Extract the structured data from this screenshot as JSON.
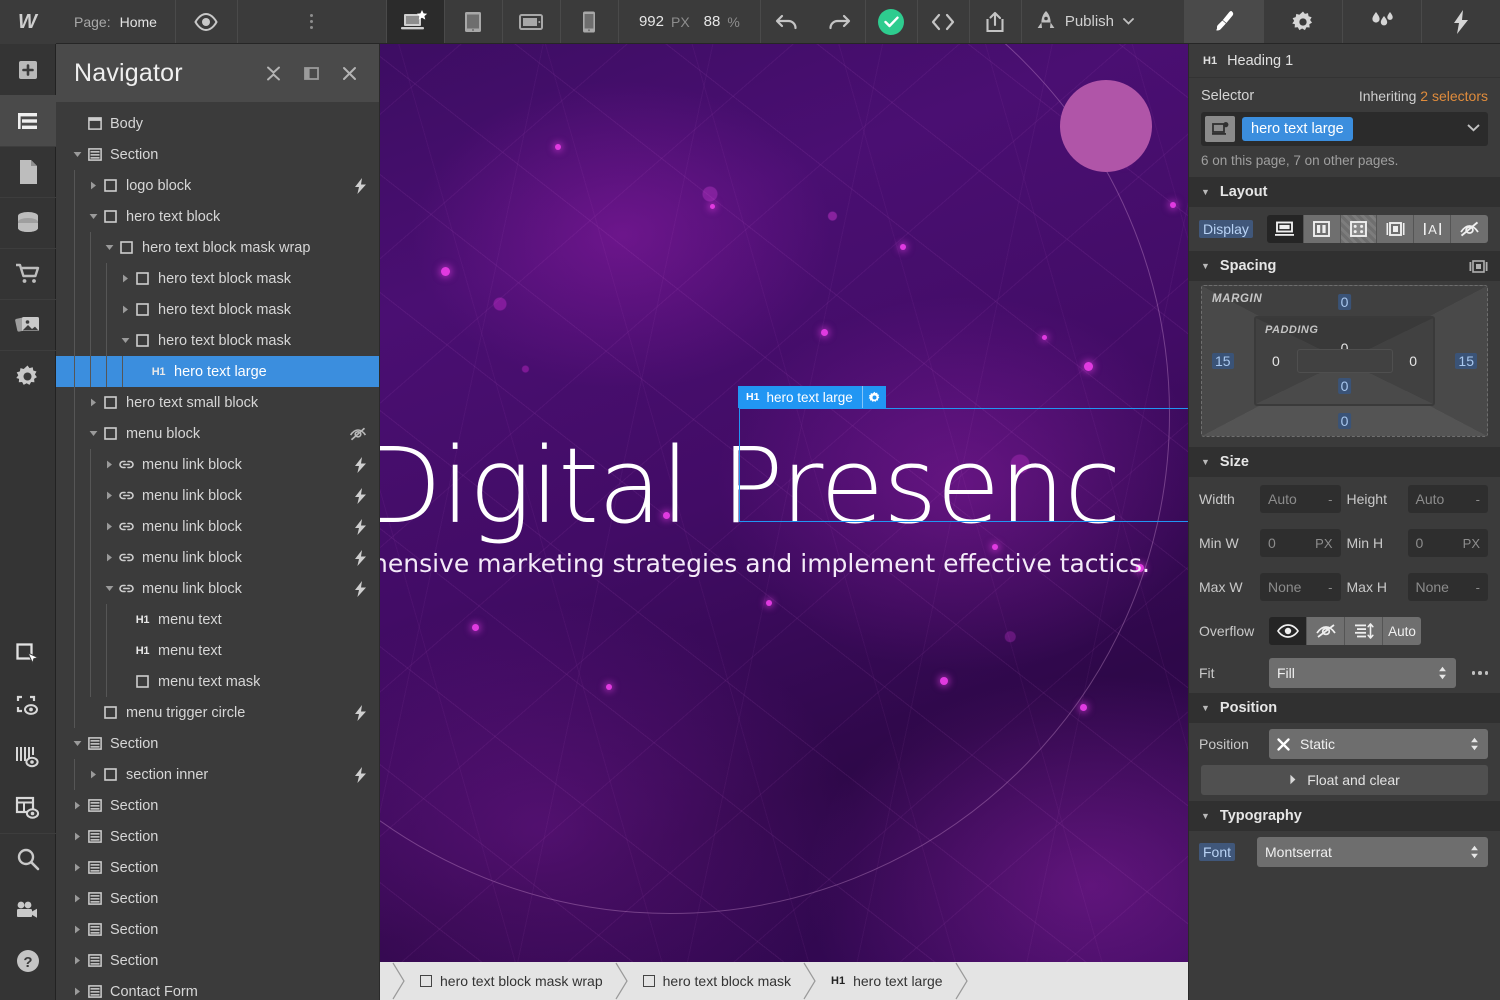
{
  "topbar": {
    "page_label": "Page:",
    "page_value": "Home",
    "preview_icon": "eye-icon",
    "more_icon": "more-options-icon",
    "devices": [
      {
        "name": "desktop",
        "icon": "desktop-icon",
        "active": true
      },
      {
        "name": "tablet",
        "icon": "tablet-icon",
        "active": false
      },
      {
        "name": "tablet-landscape",
        "icon": "tablet-landscape-icon",
        "active": false
      },
      {
        "name": "mobile",
        "icon": "mobile-icon",
        "active": false
      }
    ],
    "zoom_width": "992",
    "zoom_width_unit": "PX",
    "zoom_level": "88",
    "zoom_unit": "%",
    "undo_icon": "undo-icon",
    "redo_icon": "redo-icon",
    "status_icon": "check-circle-icon",
    "code_icon": "code-icon",
    "export_icon": "export-icon",
    "publish_label": "Publish",
    "publish_icon": "rocket-icon",
    "right_tabs": [
      {
        "name": "style",
        "icon": "paintbrush-icon",
        "active": true
      },
      {
        "name": "settings",
        "icon": "gear-icon",
        "active": false
      },
      {
        "name": "interactions",
        "icon": "droplets-icon",
        "active": false
      },
      {
        "name": "effects",
        "icon": "lightning-icon",
        "active": false
      }
    ]
  },
  "rail": {
    "logo": "W",
    "items": [
      {
        "name": "add-elements",
        "icon": "plus-icon"
      },
      {
        "name": "navigator",
        "icon": "navigator-icon",
        "active": true
      },
      {
        "name": "pages",
        "icon": "page-icon"
      },
      {
        "name": "cms",
        "icon": "database-icon"
      },
      {
        "name": "ecommerce",
        "icon": "cart-icon"
      },
      {
        "name": "assets",
        "icon": "images-icon"
      },
      {
        "name": "settings",
        "icon": "gear-icon"
      }
    ],
    "bottom_items": [
      {
        "name": "select-tool",
        "icon": "cursor-select-icon"
      },
      {
        "name": "show-element-outlines",
        "icon": "dashed-box-eye-icon"
      },
      {
        "name": "show-grid",
        "icon": "columns-eye-icon"
      },
      {
        "name": "show-layout",
        "icon": "layout-eye-icon"
      },
      {
        "name": "search",
        "icon": "search-icon"
      },
      {
        "name": "video-tutorials",
        "icon": "video-camera-icon"
      },
      {
        "name": "help",
        "icon": "question-circle-icon"
      }
    ]
  },
  "navigator": {
    "title": "Navigator",
    "header_icons": [
      "collapse-all-icon",
      "dock-panel-icon",
      "close-icon"
    ],
    "tree": [
      {
        "label": "Body",
        "indent": 0,
        "icon": "body-icon",
        "arrow": "none",
        "badge": "none"
      },
      {
        "label": "Section",
        "indent": 0,
        "icon": "section-icon",
        "arrow": "open",
        "badge": "none"
      },
      {
        "label": "logo block",
        "indent": 1,
        "icon": "div-icon",
        "arrow": "closed",
        "badge": "bolt"
      },
      {
        "label": "hero text block",
        "indent": 1,
        "icon": "div-icon",
        "arrow": "open",
        "badge": "none"
      },
      {
        "label": "hero text block mask wrap",
        "indent": 2,
        "icon": "div-icon",
        "arrow": "open",
        "badge": "none"
      },
      {
        "label": "hero text block mask",
        "indent": 3,
        "icon": "div-icon",
        "arrow": "closed",
        "badge": "none"
      },
      {
        "label": "hero text block mask",
        "indent": 3,
        "icon": "div-icon",
        "arrow": "closed",
        "badge": "none"
      },
      {
        "label": "hero text block mask",
        "indent": 3,
        "icon": "div-icon",
        "arrow": "open",
        "badge": "none"
      },
      {
        "label": "hero text large",
        "indent": 4,
        "icon": "h1-icon",
        "arrow": "none",
        "badge": "none",
        "selected": true
      },
      {
        "label": "hero text small block",
        "indent": 1,
        "icon": "div-icon",
        "arrow": "closed",
        "badge": "none"
      },
      {
        "label": "menu block",
        "indent": 1,
        "icon": "div-icon",
        "arrow": "open",
        "badge": "hidden"
      },
      {
        "label": "menu link block",
        "indent": 2,
        "icon": "link-icon",
        "arrow": "closed",
        "badge": "bolt"
      },
      {
        "label": "menu link block",
        "indent": 2,
        "icon": "link-icon",
        "arrow": "closed",
        "badge": "bolt"
      },
      {
        "label": "menu link block",
        "indent": 2,
        "icon": "link-icon",
        "arrow": "closed",
        "badge": "bolt"
      },
      {
        "label": "menu link block",
        "indent": 2,
        "icon": "link-icon",
        "arrow": "closed",
        "badge": "bolt"
      },
      {
        "label": "menu link block",
        "indent": 2,
        "icon": "link-icon",
        "arrow": "open",
        "badge": "bolt"
      },
      {
        "label": "menu text",
        "indent": 3,
        "icon": "h1-icon",
        "arrow": "none",
        "badge": "none"
      },
      {
        "label": "menu text",
        "indent": 3,
        "icon": "h1-icon",
        "arrow": "none",
        "badge": "none"
      },
      {
        "label": "menu text mask",
        "indent": 3,
        "icon": "div-icon",
        "arrow": "none",
        "badge": "none"
      },
      {
        "label": "menu trigger circle",
        "indent": 1,
        "icon": "div-icon",
        "arrow": "none",
        "badge": "bolt"
      },
      {
        "label": "Section",
        "indent": 0,
        "icon": "section-icon",
        "arrow": "open",
        "badge": "none"
      },
      {
        "label": "section inner",
        "indent": 1,
        "icon": "div-icon",
        "arrow": "closed",
        "badge": "bolt"
      },
      {
        "label": "Section",
        "indent": 0,
        "icon": "section-icon",
        "arrow": "closed",
        "badge": "none"
      },
      {
        "label": "Section",
        "indent": 0,
        "icon": "section-icon",
        "arrow": "closed",
        "badge": "none"
      },
      {
        "label": "Section",
        "indent": 0,
        "icon": "section-icon",
        "arrow": "closed",
        "badge": "none"
      },
      {
        "label": "Section",
        "indent": 0,
        "icon": "section-icon",
        "arrow": "closed",
        "badge": "none"
      },
      {
        "label": "Section",
        "indent": 0,
        "icon": "section-icon",
        "arrow": "closed",
        "badge": "none"
      },
      {
        "label": "Section",
        "indent": 0,
        "icon": "section-icon",
        "arrow": "closed",
        "badge": "none"
      },
      {
        "label": "Contact Form",
        "indent": 0,
        "icon": "section-icon",
        "arrow": "closed",
        "badge": "none"
      }
    ]
  },
  "canvas": {
    "hero_heading": "Digital Presenc",
    "hero_subtext": "hensive marketing strategies and implement effective tactics.",
    "selection_tag": "hero text large",
    "selection_tag_prefix": "H1",
    "selection_gear_icon": "gear-icon",
    "breadcrumbs": [
      {
        "label": "hero text block mask wrap",
        "icon": "div-icon"
      },
      {
        "label": "hero text block mask",
        "icon": "div-icon"
      },
      {
        "label": "hero text large",
        "icon": "h1-icon"
      }
    ],
    "colors": {
      "accent_blue": "#2196f3",
      "circle_pink": "#b055a8",
      "bg_purple": "#4a0f72"
    }
  },
  "style_panel": {
    "element_tag": "H1",
    "element_name": "Heading 1",
    "selector_label": "Selector",
    "inheriting_prefix": "Inheriting",
    "inheriting_count": "2 selectors",
    "class_chip": "hero text large",
    "class_state_icon": "state-icon",
    "class_note": "6 on this page, 7 on other pages.",
    "layout": {
      "title": "Layout",
      "display_label": "Display",
      "options": [
        {
          "name": "display-block",
          "icon": "block-icon",
          "active": true
        },
        {
          "name": "display-flex",
          "icon": "flex-icon",
          "active": false
        },
        {
          "name": "display-grid",
          "icon": "grid-icon",
          "active": false
        },
        {
          "name": "display-inline-block",
          "icon": "inline-block-icon",
          "active": false
        },
        {
          "name": "display-inline",
          "icon": "inline-icon",
          "active": false
        },
        {
          "name": "display-none",
          "icon": "none-icon",
          "active": false
        }
      ]
    },
    "spacing": {
      "title": "Spacing",
      "margin_label": "MARGIN",
      "padding_label": "PADDING",
      "margin_top": "0",
      "margin_bottom": "0",
      "margin_left": "15",
      "margin_right": "15",
      "padding_top": "0",
      "padding_bottom": "0",
      "padding_left": "0",
      "padding_right": "0",
      "link_icon": "link-sides-icon"
    },
    "size": {
      "title": "Size",
      "width_label": "Width",
      "width_value": "Auto",
      "width_unit": "-",
      "height_label": "Height",
      "height_value": "Auto",
      "height_unit": "-",
      "minw_label": "Min W",
      "minw_value": "0",
      "minw_unit": "PX",
      "minh_label": "Min H",
      "minh_value": "0",
      "minh_unit": "PX",
      "maxw_label": "Max W",
      "maxw_value": "None",
      "maxw_unit": "-",
      "maxh_label": "Max H",
      "maxh_value": "None",
      "maxh_unit": "-",
      "overflow_label": "Overflow",
      "overflow_options": [
        {
          "name": "overflow-visible",
          "icon": "eye-icon",
          "active": true
        },
        {
          "name": "overflow-hidden",
          "icon": "eye-slash-icon",
          "active": false
        },
        {
          "name": "overflow-scroll",
          "icon": "scroll-icon",
          "active": false
        },
        {
          "name": "overflow-auto",
          "label": "Auto",
          "active": false
        }
      ],
      "fit_label": "Fit",
      "fit_value": "Fill",
      "fit_more_icon": "more-icon"
    },
    "position": {
      "title": "Position",
      "position_label": "Position",
      "position_value": "Static",
      "position_clear_icon": "x-icon",
      "float_label": "Float and clear",
      "float_arrow_icon": "chevron-right-icon"
    },
    "typography": {
      "title": "Typography",
      "font_label": "Font",
      "font_value": "Montserrat"
    }
  }
}
